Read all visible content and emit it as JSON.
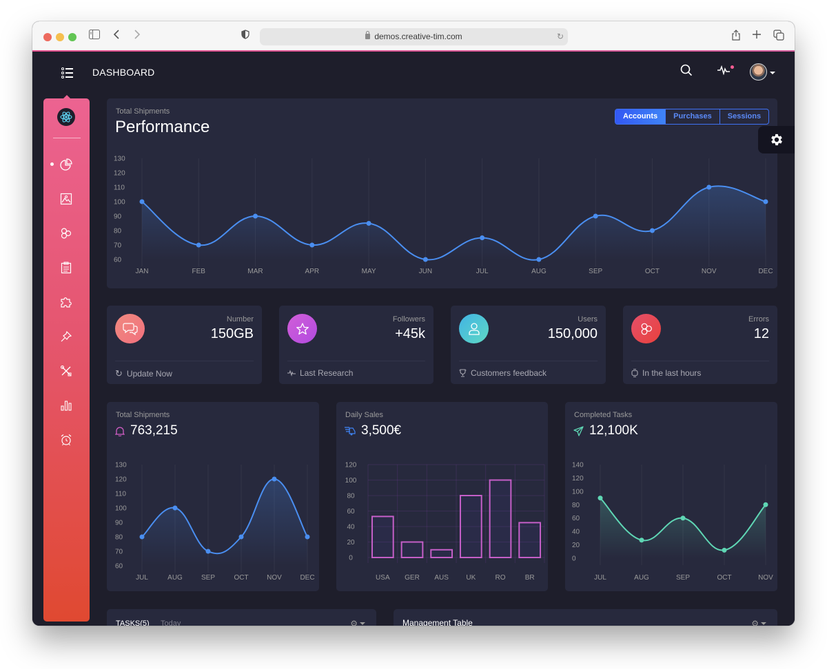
{
  "browser": {
    "url": "demos.creative-tim.com"
  },
  "topnav": {
    "brand": "DASHBOARD",
    "icons": [
      "search-icon",
      "activity-icon",
      "avatar"
    ]
  },
  "sidebar": {
    "items": [
      {
        "name": "chart-pie-icon",
        "active": true
      },
      {
        "name": "image-icon",
        "active": false
      },
      {
        "name": "atom-icon",
        "active": false
      },
      {
        "name": "paper-icon",
        "active": false
      },
      {
        "name": "puzzle-icon",
        "active": false
      },
      {
        "name": "pin-icon",
        "active": false
      },
      {
        "name": "settings-tools-icon",
        "active": false
      },
      {
        "name": "chart-bar-icon",
        "active": false
      },
      {
        "name": "alarm-icon",
        "active": false
      }
    ]
  },
  "performance": {
    "subtitle": "Total Shipments",
    "title": "Performance",
    "tabs": [
      {
        "label": "Accounts",
        "active": true
      },
      {
        "label": "Purchases",
        "active": false
      },
      {
        "label": "Sessions",
        "active": false
      }
    ]
  },
  "stats": [
    {
      "label": "Number",
      "value": "150GB",
      "footer": "Update Now",
      "icon": "chat-icon",
      "footer_icon": "refresh-icon",
      "color_from": "#f08a7f",
      "color_to": "#f1707e"
    },
    {
      "label": "Followers",
      "value": "+45k",
      "footer": "Last Research",
      "icon": "star-icon",
      "footer_icon": "sound-wave-icon",
      "color_from": "#d15ed8",
      "color_to": "#b24be0"
    },
    {
      "label": "Users",
      "value": "150,000",
      "footer": "Customers feedback",
      "icon": "user-icon",
      "footer_icon": "trophy-icon",
      "color_from": "#41b3e4",
      "color_to": "#5fd9c4"
    },
    {
      "label": "Errors",
      "value": "12",
      "footer": "In the last hours",
      "icon": "molecule-icon",
      "footer_icon": "watch-icon",
      "color_from": "#e4506a",
      "color_to": "#e9413d"
    }
  ],
  "cards": {
    "shipments": {
      "subtitle": "Total Shipments",
      "value": "763,215",
      "icon": "bell-icon"
    },
    "sales": {
      "subtitle": "Daily Sales",
      "value": "3,500€",
      "icon": "delivery-fast-icon"
    },
    "tasks": {
      "subtitle": "Completed Tasks",
      "value": "12,100K",
      "icon": "send-icon"
    }
  },
  "bottom": {
    "tasks_title": "TASKS(5)",
    "tasks_sub": "Today",
    "table_title": "Management Table"
  },
  "colors": {
    "accent_blue": "#3f84f6",
    "line_blue": "#4a8ef0",
    "bar_pink": "#c55fc8",
    "line_green": "#5fd6b4",
    "sidebar_top": "#ec6391",
    "sidebar_bottom": "#e04931"
  },
  "chart_data": [
    {
      "id": "performance",
      "type": "line",
      "title": "Performance",
      "categories": [
        "JAN",
        "FEB",
        "MAR",
        "APR",
        "MAY",
        "JUN",
        "JUL",
        "AUG",
        "SEP",
        "OCT",
        "NOV",
        "DEC"
      ],
      "values": [
        100,
        70,
        90,
        70,
        85,
        60,
        75,
        60,
        90,
        80,
        110,
        100
      ],
      "yticks": [
        60,
        70,
        80,
        90,
        100,
        110,
        120,
        130
      ],
      "ylim": [
        60,
        130
      ],
      "grid": "vertical"
    },
    {
      "id": "shipments",
      "type": "line",
      "title": "Total Shipments",
      "categories": [
        "JUL",
        "AUG",
        "SEP",
        "OCT",
        "NOV",
        "DEC"
      ],
      "values": [
        80,
        100,
        70,
        80,
        120,
        80
      ],
      "yticks": [
        60,
        70,
        80,
        90,
        100,
        110,
        120,
        130
      ],
      "ylim": [
        60,
        130
      ],
      "grid": "vertical"
    },
    {
      "id": "sales",
      "type": "bar",
      "title": "Daily Sales",
      "categories": [
        "USA",
        "GER",
        "AUS",
        "UK",
        "RO",
        "BR"
      ],
      "values": [
        53,
        20,
        10,
        80,
        100,
        45
      ],
      "yticks": [
        0,
        20,
        40,
        60,
        80,
        100,
        120
      ],
      "ylim": [
        0,
        120
      ],
      "grid": "both"
    },
    {
      "id": "tasks",
      "type": "line",
      "title": "Completed Tasks",
      "categories": [
        "JUL",
        "AUG",
        "SEP",
        "OCT",
        "NOV"
      ],
      "values": [
        90,
        27,
        60,
        12,
        80
      ],
      "yticks": [
        0,
        20,
        40,
        60,
        80,
        100,
        120,
        140
      ],
      "ylim": [
        0,
        140
      ],
      "grid": "vertical"
    }
  ]
}
